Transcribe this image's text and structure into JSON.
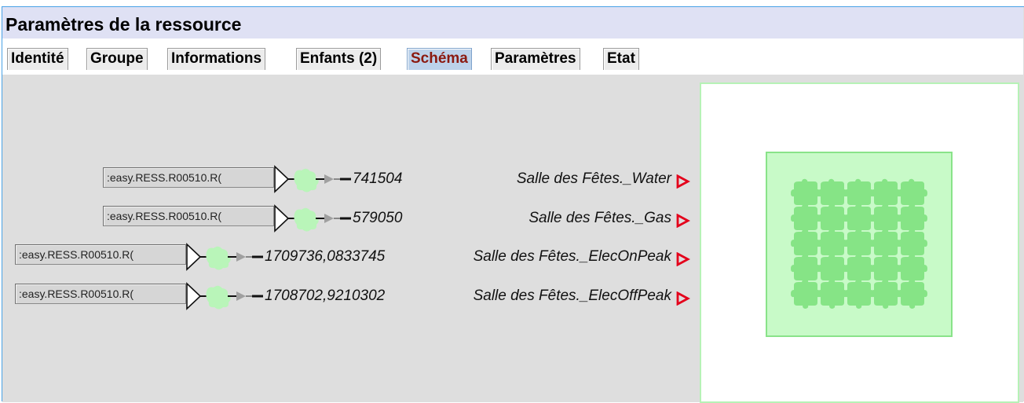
{
  "header": {
    "title": "Paramètres de la ressource"
  },
  "tabs": [
    {
      "label": "Identité",
      "active": false
    },
    {
      "label": "Groupe",
      "active": false
    },
    {
      "label": "Informations",
      "active": false
    },
    {
      "label": "Enfants (2)",
      "active": false
    },
    {
      "label": "Schéma",
      "active": true
    },
    {
      "label": "Paramètres",
      "active": false
    },
    {
      "label": "Etat",
      "active": false
    }
  ],
  "schema": {
    "rows": [
      {
        "resource": ":easy.RESS.R00510.R(",
        "value": "741504",
        "label": "Salle des Fêtes._Water"
      },
      {
        "resource": ":easy.RESS.R00510.R(",
        "value": "579050",
        "label": "Salle des Fêtes._Gas"
      },
      {
        "resource": ":easy.RESS.R00510.R(",
        "value": "1709736,0833745",
        "label": "Salle des Fêtes._ElecOnPeak"
      },
      {
        "resource": ":easy.RESS.R00510.R(",
        "value": "1708702,9210302",
        "label": "Salle des Fêtes._ElecOffPeak"
      }
    ]
  },
  "colors": {
    "accent_border": "#49a2e6",
    "title_bg": "#dfe1f4",
    "active_tab_text": "#8b1a10",
    "arrow_red": "#e4001b",
    "node_green": "#b9f5b9",
    "overview_fill": "#c8fac8",
    "overview_tile": "#86e486"
  },
  "icons": {
    "connector": "triangle-node-arrow-icon",
    "row_action": "red-triangle-arrow-icon",
    "overview_tile": "puzzle-tile-icon"
  }
}
